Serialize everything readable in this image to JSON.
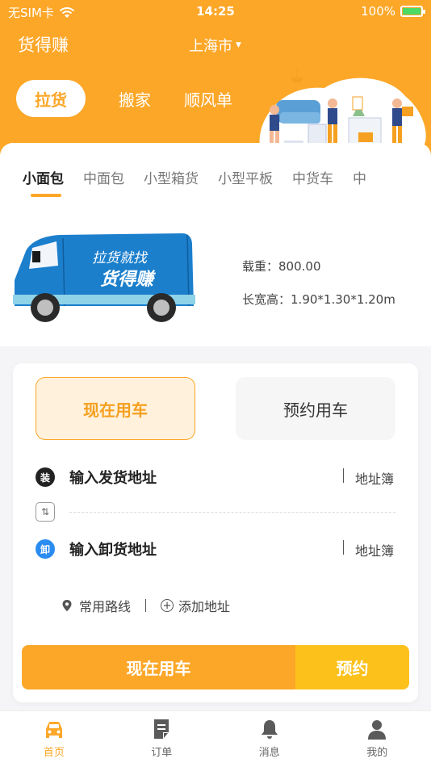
{
  "status_bar": {
    "carrier": "无SIM卡",
    "time": "14:25",
    "battery": "100%"
  },
  "header": {
    "app_title": "货得赚",
    "city": "上海市",
    "service_tabs": [
      {
        "label": "拉货",
        "active": true
      },
      {
        "label": "搬家",
        "active": false
      },
      {
        "label": "顺风单",
        "active": false
      }
    ]
  },
  "vehicle_tabs": [
    {
      "label": "小面包",
      "active": true
    },
    {
      "label": "中面包",
      "active": false
    },
    {
      "label": "小型箱货",
      "active": false
    },
    {
      "label": "小型平板",
      "active": false
    },
    {
      "label": "中货车",
      "active": false
    },
    {
      "label": "中",
      "active": false
    }
  ],
  "vehicle": {
    "van_text_line1": "拉货就找",
    "van_text_line2": "货得赚",
    "load_label": "载重：",
    "load_value": "800.00",
    "dims_label": "长宽高：",
    "dims_value": "1.90*1.30*1.20m"
  },
  "order": {
    "mode_now": "现在用车",
    "mode_later": "预约用车",
    "from_badge": "装",
    "from_placeholder": "输入发货地址",
    "to_badge": "卸",
    "to_placeholder": "输入卸货地址",
    "address_book": "地址簿",
    "common_routes": "常用路线",
    "add_address": "添加地址",
    "action_now": "现在用车",
    "action_reserve": "预约"
  },
  "bottom_nav": [
    {
      "label": "首页",
      "icon": "car-icon",
      "active": true
    },
    {
      "label": "订单",
      "icon": "order-icon",
      "active": false
    },
    {
      "label": "消息",
      "icon": "bell-icon",
      "active": false
    },
    {
      "label": "我的",
      "icon": "person-icon",
      "active": false
    }
  ],
  "colors": {
    "primary": "#fca728",
    "reserve": "#fdc11c",
    "blue_badge": "#2a8cf0"
  }
}
